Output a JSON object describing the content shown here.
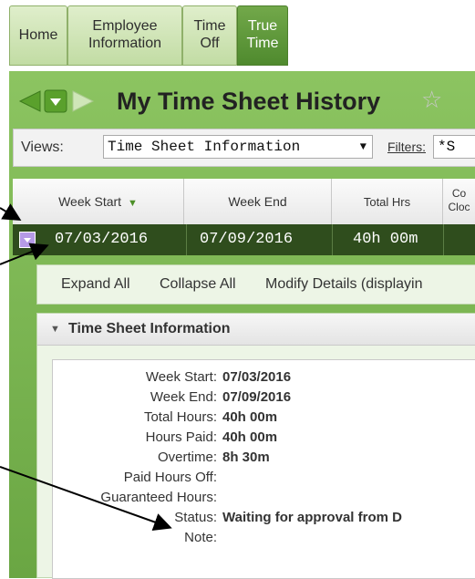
{
  "nav": {
    "tabs": [
      {
        "line1": "Home",
        "line2": ""
      },
      {
        "line1": "Employee",
        "line2": "Information"
      },
      {
        "line1": "Time",
        "line2": "Off"
      },
      {
        "line1": "True",
        "line2": "Time"
      }
    ]
  },
  "page": {
    "title": "My Time Sheet History"
  },
  "views": {
    "label": "Views:",
    "selected": "Time Sheet Information",
    "filters_label": "Filters:",
    "filter_value": "*S"
  },
  "table": {
    "headers": [
      "Week Start",
      "Week End",
      "Total Hrs",
      "Co Cloc"
    ],
    "row": {
      "week_start": "07/03/2016",
      "week_end": "07/09/2016",
      "total_hrs": "40h 00m"
    }
  },
  "actions": {
    "expand_all": "Expand All",
    "collapse_all": "Collapse All",
    "modify_details": "Modify Details (displayin"
  },
  "details": {
    "section_title": "Time Sheet Information",
    "fields": [
      {
        "label": "Week Start:",
        "value": "07/03/2016"
      },
      {
        "label": "Week End:",
        "value": "07/09/2016"
      },
      {
        "label": "Total Hours:",
        "value": "40h 00m"
      },
      {
        "label": "Hours Paid:",
        "value": "40h 00m"
      },
      {
        "label": "Overtime:",
        "value": "8h 30m"
      },
      {
        "label": "Paid Hours Off:",
        "value": ""
      },
      {
        "label": "Guaranteed Hours:",
        "value": ""
      },
      {
        "label": "Status:",
        "value": "Waiting for approval from D"
      },
      {
        "label": "Note:",
        "value": ""
      }
    ]
  },
  "colors": {
    "panel_green": "#78b24e",
    "active_tab": "#5a9436",
    "row_dark": "#2f4d1d"
  }
}
